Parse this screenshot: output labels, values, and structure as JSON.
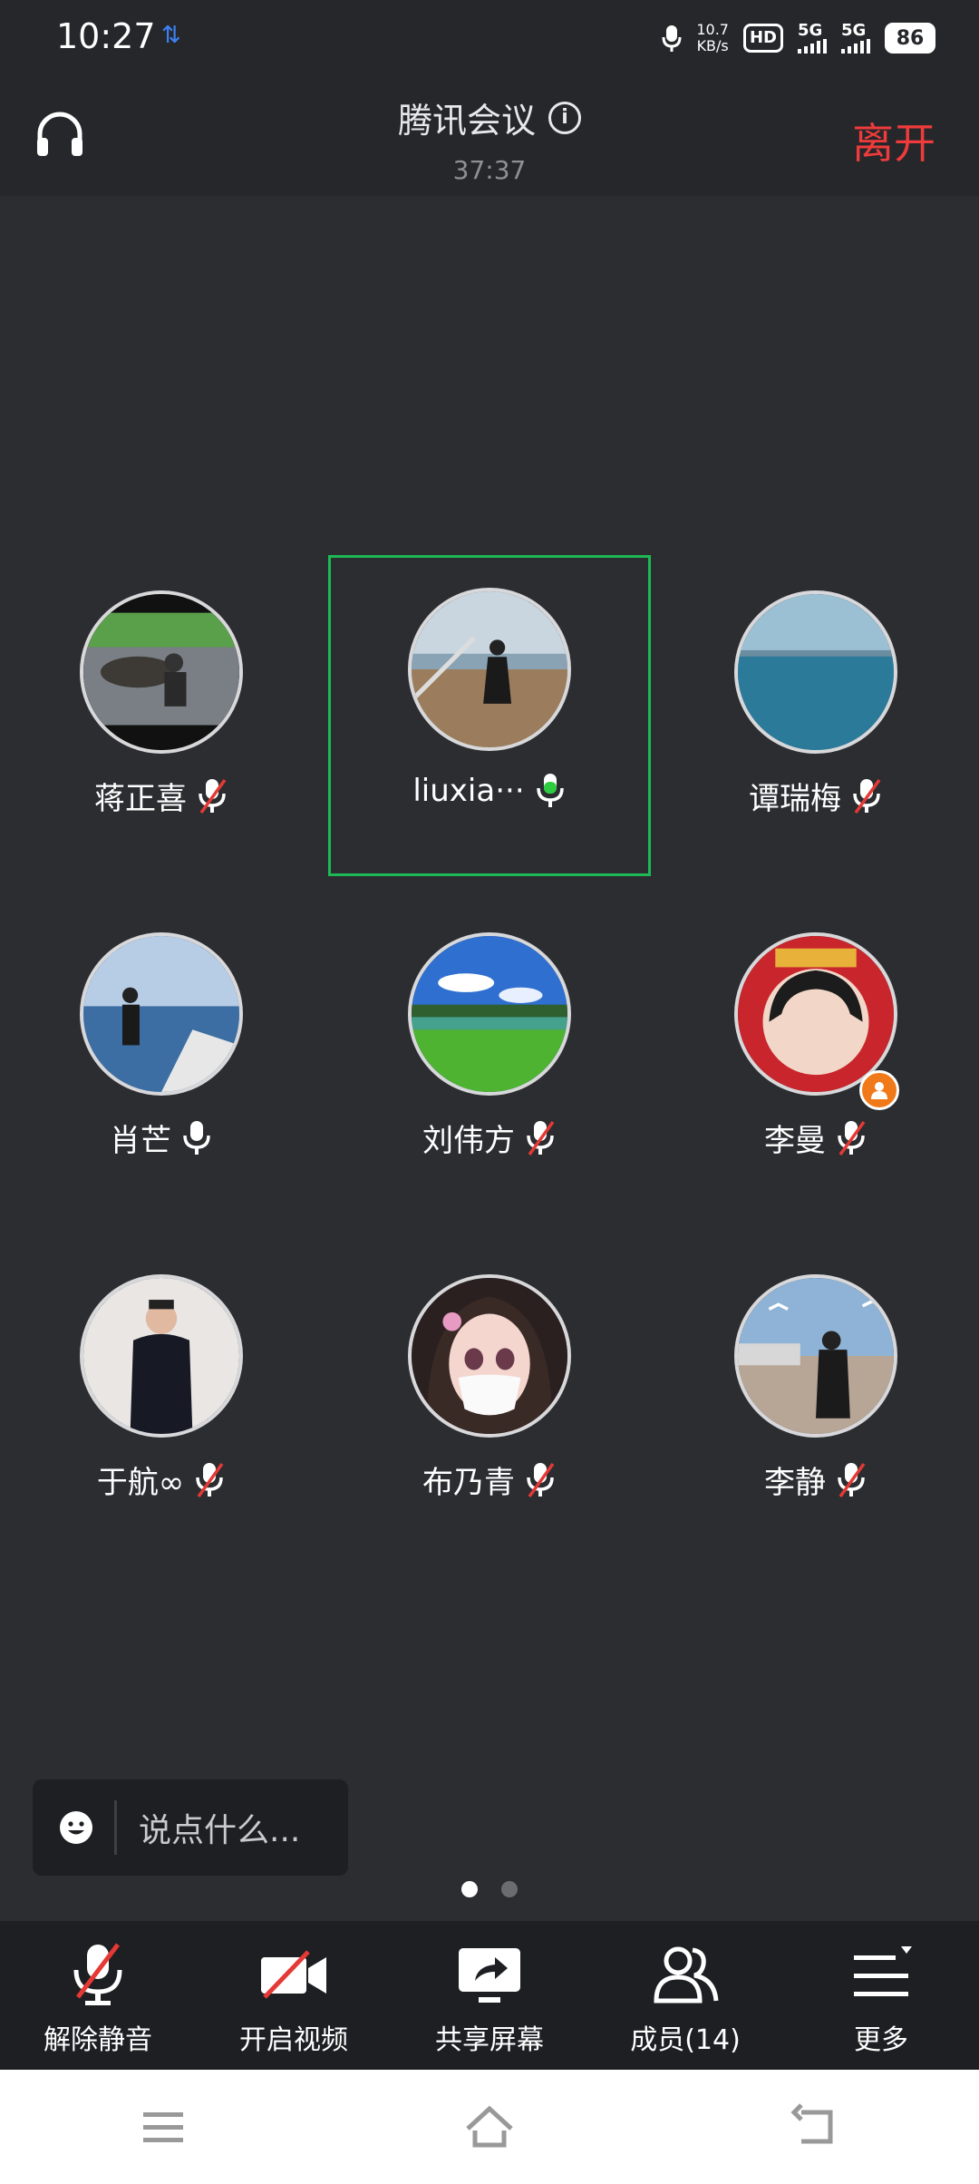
{
  "status_bar": {
    "time": "10:27",
    "net_speed_value": "10.7",
    "net_speed_unit": "KB/s",
    "hd": "HD",
    "sim1": "5G",
    "sim2": "5G",
    "battery": "86"
  },
  "header": {
    "title": "腾讯会议",
    "duration": "37:37",
    "leave_label": "离开"
  },
  "participants": [
    {
      "name": "蒋正喜",
      "muted": true,
      "speaking": false
    },
    {
      "name": "liuxia···",
      "muted": false,
      "speaking": true
    },
    {
      "name": "谭瑞梅",
      "muted": true,
      "speaking": false
    },
    {
      "name": "肖芒",
      "muted": false,
      "speaking": false
    },
    {
      "name": "刘伟方",
      "muted": true,
      "speaking": false
    },
    {
      "name": "李曼",
      "muted": true,
      "speaking": false,
      "host": true
    },
    {
      "name": "于航∞",
      "muted": true,
      "speaking": false
    },
    {
      "name": "布乃青",
      "muted": true,
      "speaking": false
    },
    {
      "name": "李静",
      "muted": true,
      "speaking": false
    }
  ],
  "chat": {
    "placeholder": "说点什么..."
  },
  "page_indicator": {
    "current": 1,
    "total": 2
  },
  "toolbar": [
    {
      "label": "解除静音",
      "icon": "mic-off-icon"
    },
    {
      "label": "开启视频",
      "icon": "video-off-icon"
    },
    {
      "label": "共享屏幕",
      "icon": "share-screen-icon"
    },
    {
      "label": "成员(14)",
      "icon": "members-icon"
    },
    {
      "label": "更多",
      "icon": "more-menu-icon"
    }
  ],
  "colors": {
    "background": "#2b2d31",
    "leave": "#ef3b3b",
    "speaking_border": "#1db954",
    "mic_active": "#2ecc40",
    "mute_slash": "#e53935"
  }
}
